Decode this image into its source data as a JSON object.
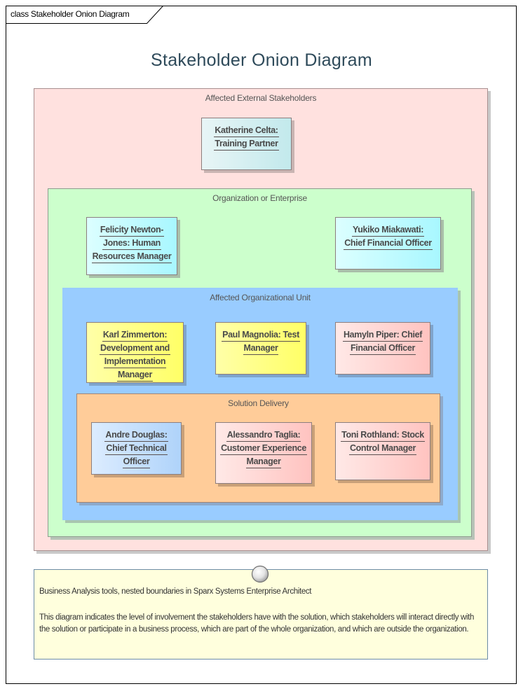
{
  "frame": {
    "tab_label": "class Stakeholder Onion Diagram"
  },
  "diagram": {
    "title": "Stakeholder Onion Diagram"
  },
  "boundaries": [
    {
      "name": "Affected External Stakeholders",
      "fill": "#ffe1df"
    },
    {
      "name": "Organization or Enterprise",
      "fill": "#ccffcc"
    },
    {
      "name": "Affected Organizational Unit",
      "fill": "#99ccff"
    },
    {
      "name": "Solution Delivery",
      "fill": "#ffcc99"
    }
  ],
  "stakeholders": [
    {
      "boundary": "Affected External Stakeholders",
      "label": "Katherine Celta: Training Partner",
      "lines": [
        "Katherine Celta:",
        "Training Partner"
      ]
    },
    {
      "boundary": "Organization or Enterprise",
      "label": "Felicity Newton-Jones: Human Resources Manager",
      "lines": [
        "Felicity Newton-",
        "Jones: Human",
        "Resources Manager"
      ]
    },
    {
      "boundary": "Organization or Enterprise",
      "label": "Yukiko Miakawati: Chief Financial Officer",
      "lines": [
        "Yukiko Miakawati:",
        "Chief Financial Officer"
      ]
    },
    {
      "boundary": "Affected Organizational Unit",
      "label": "Karl Zimmerton: Development and Implementation Manager",
      "lines": [
        "Karl Zimmerton:",
        "Development and",
        "Implementation",
        "Manager"
      ]
    },
    {
      "boundary": "Affected Organizational Unit",
      "label": "Paul Magnolia: Test Manager",
      "lines": [
        "Paul Magnolia: Test",
        "Manager"
      ]
    },
    {
      "boundary": "Affected Organizational Unit",
      "label": "Hamyln Piper: Chief Financial Officer",
      "lines": [
        "Hamyln Piper: Chief",
        "Financial Officer"
      ]
    },
    {
      "boundary": "Solution Delivery",
      "label": "Andre Douglas: Chief Technical Officer",
      "lines": [
        "Andre Douglas:",
        "Chief Technical",
        "Officer"
      ]
    },
    {
      "boundary": "Solution Delivery",
      "label": "Alessandro Taglia: Customer Experience Manager",
      "lines": [
        "Alessandro Taglia:",
        "Customer Experience",
        "Manager"
      ]
    },
    {
      "boundary": "Solution Delivery",
      "label": "Toni Rothland: Stock Control Manager",
      "lines": [
        "Toni Rothland: Stock",
        "Control Manager"
      ]
    }
  ],
  "note": {
    "heading": "Business Analysis tools, nested boundaries in Sparx Systems Enterprise Architect",
    "body": "This diagram indicates the level of involvement the stakeholders have with the solution, which stakeholders will interact directly with the solution or participate in a business process, which are part of the whole organization, and which are outside the organization."
  }
}
